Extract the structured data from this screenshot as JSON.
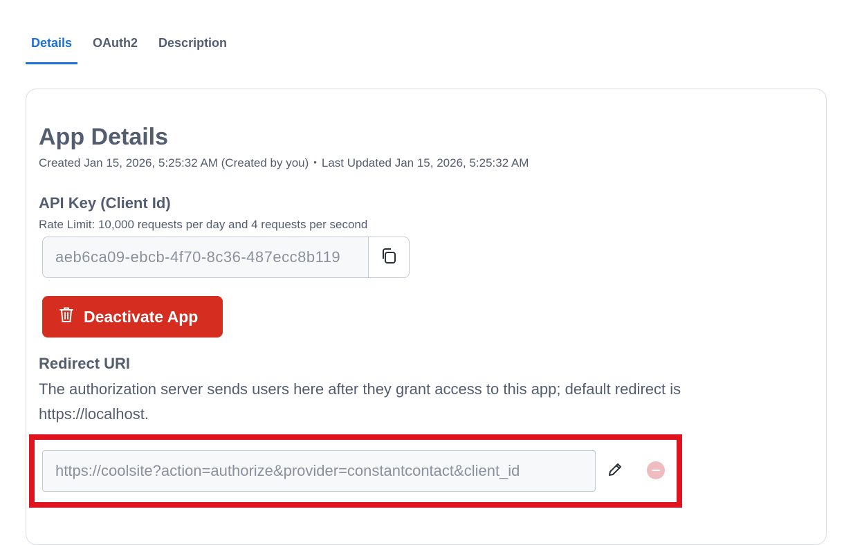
{
  "tabs": [
    {
      "label": "Details",
      "active": true
    },
    {
      "label": "OAuth2",
      "active": false
    },
    {
      "label": "Description",
      "active": false
    }
  ],
  "app_details": {
    "title": "App Details",
    "created": "Created Jan 15, 2026, 5:25:32 AM (Created by you)",
    "separator": "•",
    "updated": "Last Updated Jan 15, 2026, 5:25:32 AM"
  },
  "api_key": {
    "label": "API Key (Client Id)",
    "rate_limit": "Rate Limit: 10,000 requests per day and 4 requests per second",
    "value": "aeb6ca09-ebcb-4f70-8c36-487ecc8b119"
  },
  "deactivate": {
    "label": "Deactivate App"
  },
  "redirect": {
    "label": "Redirect URI",
    "description": "The authorization server sends users here after they grant access to this app; default redirect is https://localhost.",
    "uri_value": "https://coolsite?action=authorize&provider=constantcontact&client_id"
  },
  "colors": {
    "accent": "#1b6fd6",
    "danger": "#d52d1f",
    "highlight": "#e0141e",
    "text": "#545d70"
  },
  "icons": {
    "copy": "copy-icon",
    "trash": "trash-icon",
    "edit": "pencil-icon",
    "remove": "minus-circle-icon"
  }
}
